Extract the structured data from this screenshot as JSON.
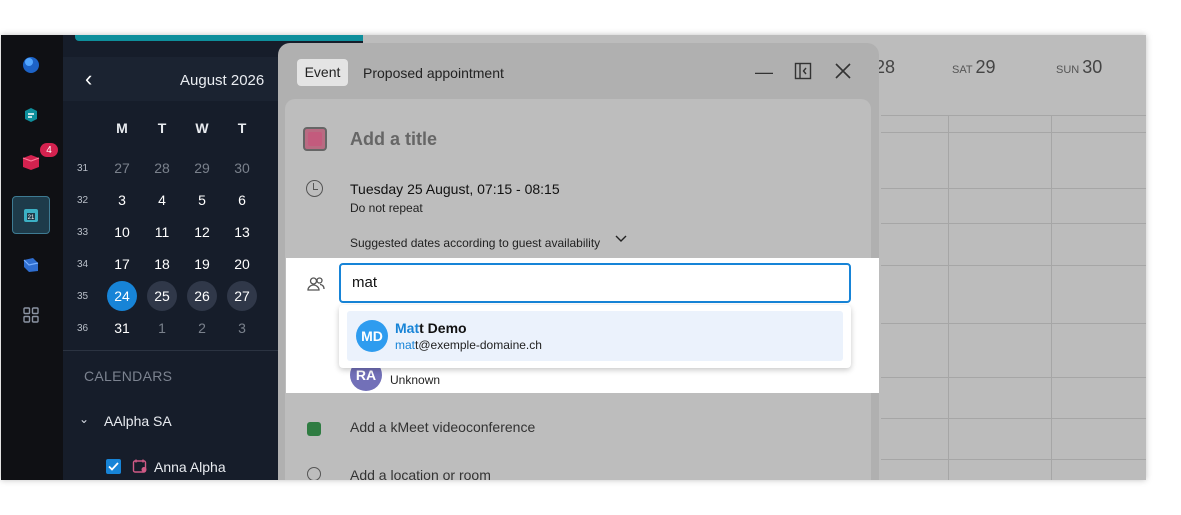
{
  "rail": {
    "badge_count": "4",
    "icons": [
      "globe-logo-icon",
      "kdrive-icon",
      "mail-icon",
      "calendar-icon",
      "contacts-icon",
      "apps-grid-icon"
    ]
  },
  "minical": {
    "month": "August",
    "year": "2026",
    "weekday_headers": [
      "M",
      "T",
      "W",
      "T"
    ],
    "weeks": [
      {
        "num": "31",
        "days": [
          "27",
          "28",
          "29",
          "30"
        ]
      },
      {
        "num": "32",
        "days": [
          "3",
          "4",
          "5",
          "6"
        ]
      },
      {
        "num": "33",
        "days": [
          "10",
          "11",
          "12",
          "13"
        ]
      },
      {
        "num": "34",
        "days": [
          "17",
          "18",
          "19",
          "20"
        ]
      },
      {
        "num": "35",
        "days": [
          "24",
          "25",
          "26",
          "27"
        ]
      },
      {
        "num": "36",
        "days": [
          "31",
          "1",
          "2",
          "3"
        ]
      }
    ],
    "today": "24"
  },
  "calendars": {
    "section_label": "CALENDARS",
    "group_name": "AAlpha SA",
    "items": [
      {
        "label": "Anna Alpha",
        "checked": true
      }
    ]
  },
  "grid": {
    "columns": [
      {
        "dow": "",
        "day": "28"
      },
      {
        "dow": "SAT",
        "day": "29"
      },
      {
        "dow": "SUN",
        "day": "30"
      }
    ]
  },
  "dialog": {
    "tab_event": "Event",
    "tab_proposed": "Proposed appointment",
    "title_placeholder": "Add a title",
    "color": "#c35b7d",
    "date_line": "Tuesday 25 August, 07:15 - 08:15",
    "repeat_line": "Do not repeat",
    "suggested_dates": "Suggested dates according to guest availability",
    "guest_query": "mat",
    "suggestion": {
      "initials": "MD",
      "name_match": "Mat",
      "name_rest": "t Demo",
      "email_match": "mat",
      "email_rest": "t@exemple-domaine.ch"
    },
    "existing_guest": {
      "initials": "RA",
      "status": "Unknown"
    },
    "kmeet_label": "Add a kMeet videoconference",
    "location_label": "Add a location or room"
  },
  "accent_color": "#1784d7"
}
